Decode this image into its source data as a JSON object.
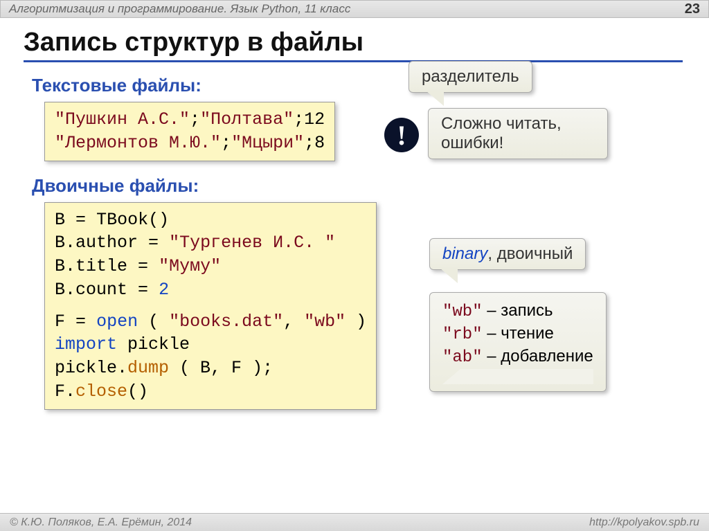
{
  "header": {
    "course_title": "Алгоритмизация и программирование. Язык Python, 11 класс",
    "page_number": "23"
  },
  "slide_title": "Запись структур в файлы",
  "text_files": {
    "heading": "Текстовые файлы:",
    "lines": [
      {
        "s1": "\"Пушкин А.С.\"",
        "sep1": ";",
        "s2": "\"Полтава\"",
        "sep2": ";",
        "n": "12"
      },
      {
        "s1": "\"Лермонтов М.Ю.\"",
        "sep1": ";",
        "s2": "\"Мцыри\"",
        "sep2": ";",
        "n": "8"
      }
    ],
    "separator_label": "разделитель",
    "warning_text": "Сложно читать, ошибки!",
    "warning_mark": "!"
  },
  "binary_files": {
    "heading": "Двоичные файлы:",
    "code": {
      "l1a": "B",
      "l1b": "=",
      "l1c": "TBook()",
      "l2a": "B.author",
      "l2b": "=",
      "l2c": "\"Тургенев И.С. \"",
      "l3a": "B.title",
      "l3b": "=",
      "l3c": "\"Муму\"",
      "l4a": "B.count",
      "l4b": "=",
      "l4c": "2",
      "l5a": "F",
      "l5b": "=",
      "l5c": "open",
      "l5d": " ( ",
      "l5e": "\"books.dat\"",
      "l5f": ", ",
      "l5g": "\"wb\"",
      "l5h": " )",
      "l6a": "import",
      "l6b": " pickle",
      "l7a": "pickle.",
      "l7b": "dump",
      "l7c": " ( B, F );",
      "l8a": "F.",
      "l8b": "close",
      "l8c": "()"
    },
    "binary_label_en": "binary",
    "binary_label_ru": ", двоичный",
    "modes": [
      {
        "mode": "\"wb\"",
        "desc": " – запись"
      },
      {
        "mode": "\"rb\"",
        "desc": " – чтение"
      },
      {
        "mode": "\"ab\"",
        "desc": " – добавление"
      }
    ]
  },
  "footer": {
    "copyright": "© К.Ю. Поляков, Е.А. Ерёмин, 2014",
    "url": "http://kpolyakov.spb.ru"
  }
}
